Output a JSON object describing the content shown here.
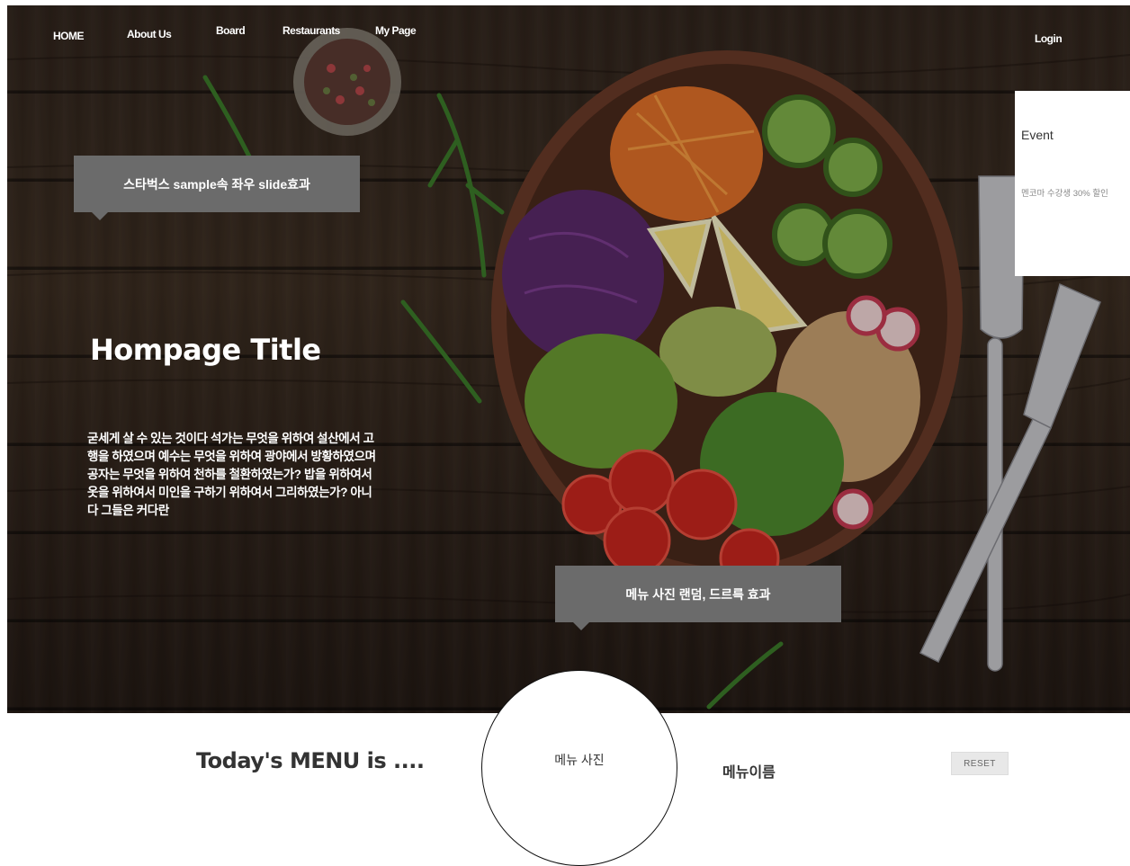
{
  "nav": {
    "items": [
      "HOME",
      "About Us",
      "Board",
      "Restaurants",
      "My Page"
    ],
    "login": "Login"
  },
  "hero": {
    "callout_top": "스타벅스 sample속 좌우 slide효과",
    "title": "Hompage Title",
    "body": "굳세게 살 수 있는 것이다 석가는 무엇을 위하여 설산에서 고행을 하였으며 예수는 무엇을 위하여 광야에서 방황하였으며 공자는 무엇을 위하여 천하를 철환하였는가? 밥을 위하여서 옷을 위하여서 미인을 구하기 위하여서 그리하였는가? 아니다 그들은 커다란",
    "callout_bottom": "메뉴 사진 랜덤, 드르륵 효과"
  },
  "event": {
    "title": "Event",
    "text": "멘코마 수강생 30% 할인"
  },
  "today": {
    "label": "Today's MENU is ....",
    "photo_label": "메뉴 사진",
    "menu_name": "메뉴이름",
    "reset": "RESET"
  },
  "colors": {
    "callout_bg": "#6b6b6b",
    "wood_dark": "#3d2e24",
    "event_bg": "#ffffff"
  }
}
